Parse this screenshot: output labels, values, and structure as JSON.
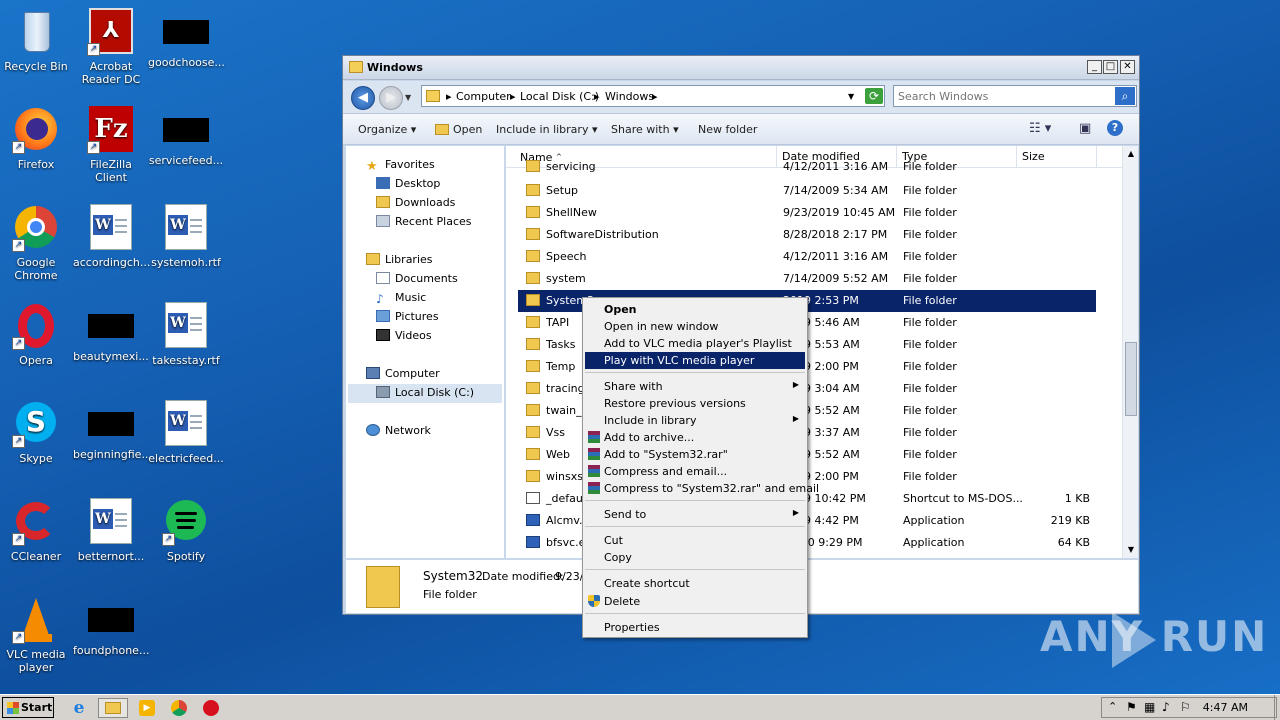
{
  "desktop": {
    "icons": [
      {
        "label": "Recycle Bin"
      },
      {
        "label": "Acrobat Reader DC"
      },
      {
        "label": "goodchoose..."
      },
      {
        "label": "Firefox"
      },
      {
        "label": "FileZilla Client"
      },
      {
        "label": "servicefeed..."
      },
      {
        "label": "Google Chrome"
      },
      {
        "label": "accordingch..."
      },
      {
        "label": "systemoh.rtf"
      },
      {
        "label": "Opera"
      },
      {
        "label": "beautymexi..."
      },
      {
        "label": "takesstay.rtf"
      },
      {
        "label": "Skype"
      },
      {
        "label": "beginningfie..."
      },
      {
        "label": "electricfeed..."
      },
      {
        "label": "CCleaner"
      },
      {
        "label": "betternort..."
      },
      {
        "label": "Spotify"
      },
      {
        "label": "VLC media player"
      },
      {
        "label": "foundphone..."
      }
    ]
  },
  "window": {
    "title": "Windows",
    "breadcrumb": [
      "Computer",
      "Local Disk (C:)",
      "Windows"
    ],
    "search_placeholder": "Search Windows",
    "toolbar": {
      "organize": "Organize",
      "open": "Open",
      "include": "Include in library",
      "share": "Share with",
      "newfolder": "New folder"
    },
    "nav": {
      "favorites": "Favorites",
      "desktop": "Desktop",
      "downloads": "Downloads",
      "recent": "Recent Places",
      "libraries": "Libraries",
      "documents": "Documents",
      "music": "Music",
      "pictures": "Pictures",
      "videos": "Videos",
      "computer": "Computer",
      "localdisk": "Local Disk (C:)",
      "network": "Network"
    },
    "columns": {
      "name": "Name",
      "date": "Date modified",
      "type": "Type",
      "size": "Size"
    },
    "rows": [
      {
        "name": "servicing",
        "date": "4/12/2011 3:16 AM",
        "type": "File folder",
        "size": ""
      },
      {
        "name": "Setup",
        "date": "7/14/2009 5:34 AM",
        "type": "File folder",
        "size": ""
      },
      {
        "name": "ShellNew",
        "date": "9/23/2019 10:45 AM",
        "type": "File folder",
        "size": ""
      },
      {
        "name": "SoftwareDistribution",
        "date": "8/28/2018 2:17 PM",
        "type": "File folder",
        "size": ""
      },
      {
        "name": "Speech",
        "date": "4/12/2011 3:16 AM",
        "type": "File folder",
        "size": ""
      },
      {
        "name": "system",
        "date": "7/14/2009 5:52 AM",
        "type": "File folder",
        "size": ""
      },
      {
        "name": "System3",
        "date": "2019 2:53 PM",
        "type": "File folder",
        "size": ""
      },
      {
        "name": "TAPI",
        "date": "2009 5:46 AM",
        "type": "File folder",
        "size": ""
      },
      {
        "name": "Tasks",
        "date": "2009 5:53 AM",
        "type": "File folder",
        "size": ""
      },
      {
        "name": "Temp",
        "date": "2019 2:00 PM",
        "type": "File folder",
        "size": ""
      },
      {
        "name": "tracing",
        "date": "2009 3:04 AM",
        "type": "File folder",
        "size": ""
      },
      {
        "name": "twain_3",
        "date": "2009 5:52 AM",
        "type": "File folder",
        "size": ""
      },
      {
        "name": "Vss",
        "date": "2009 3:37 AM",
        "type": "File folder",
        "size": ""
      },
      {
        "name": "Web",
        "date": "2009 5:52 AM",
        "type": "File folder",
        "size": ""
      },
      {
        "name": "winsxs",
        "date": "2019 2:00 PM",
        "type": "File folder",
        "size": ""
      },
      {
        "name": "_default",
        "date": "2009 10:42 PM",
        "type": "Shortcut to MS-DOS...",
        "size": "1 KB"
      },
      {
        "name": "Alcmv.e",
        "date": "2009 4:42 PM",
        "type": "Application",
        "size": "219 KB"
      },
      {
        "name": "bfsvc.ex",
        "date": "/2010 9:29 PM",
        "type": "Application",
        "size": "64 KB"
      }
    ],
    "details": {
      "name": "System32",
      "date_label": "Date modified:",
      "date_value": "9/23/",
      "type": "File folder"
    }
  },
  "context_menu": {
    "open": "Open",
    "open_new_window": "Open in new window",
    "vlc_playlist": "Add to VLC media player's Playlist",
    "vlc_play": "Play with VLC media player",
    "share_with": "Share with",
    "restore": "Restore previous versions",
    "include": "Include in library",
    "add_archive": "Add to archive...",
    "add_rar": "Add to \"System32.rar\"",
    "compress_email": "Compress and email...",
    "compress_rar_email": "Compress to \"System32.rar\" and email",
    "send_to": "Send to",
    "cut": "Cut",
    "copy": "Copy",
    "create_shortcut": "Create shortcut",
    "delete": "Delete",
    "properties": "Properties"
  },
  "taskbar": {
    "start": "Start",
    "clock": "4:47 AM"
  },
  "watermark": "ANY  RUN"
}
